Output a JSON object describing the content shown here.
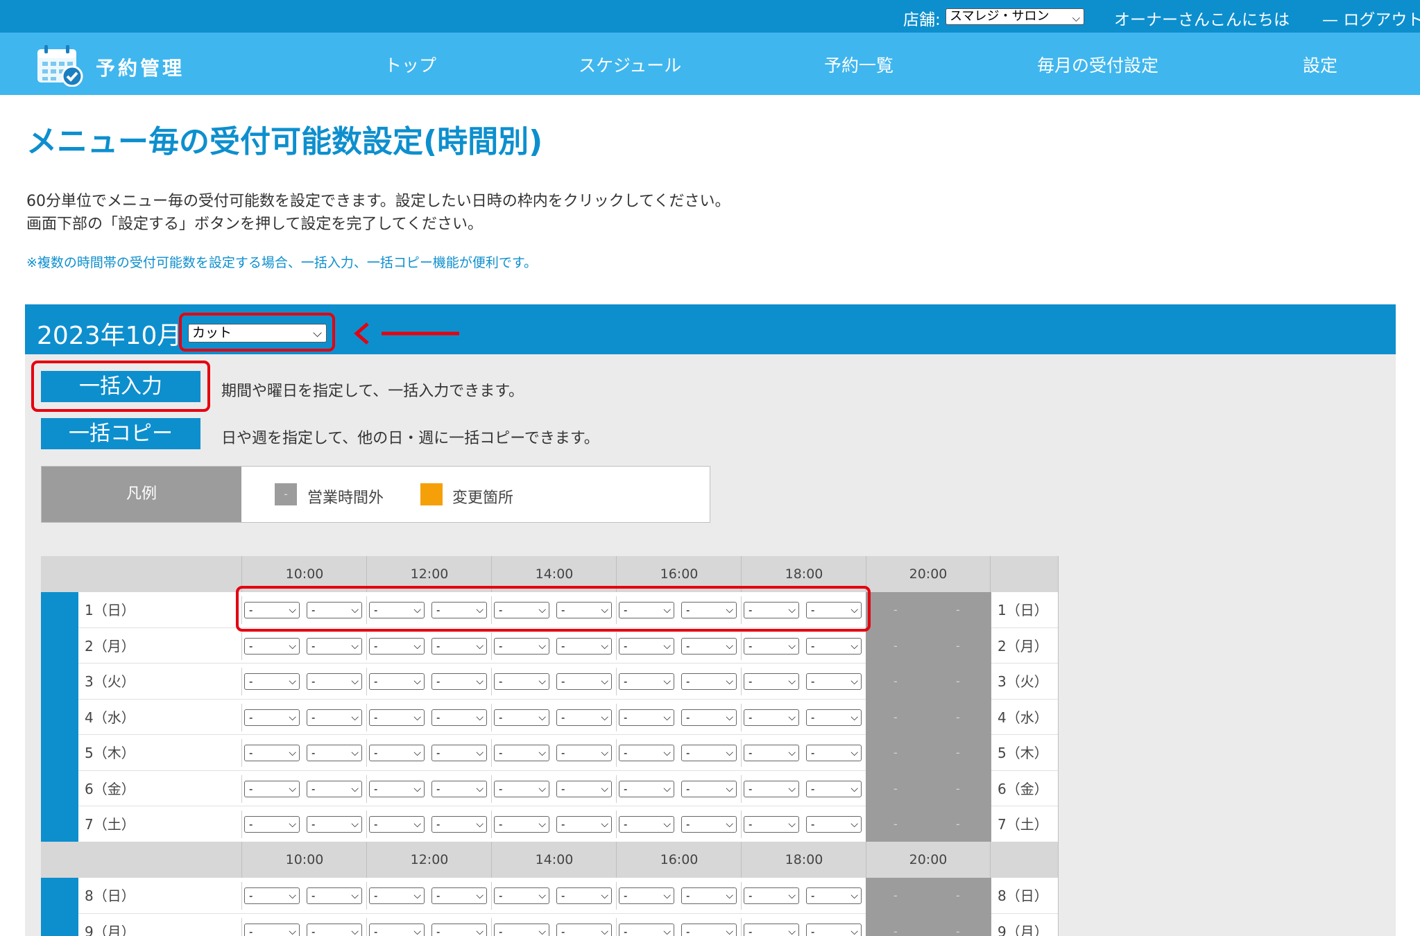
{
  "topbar": {
    "store_label": "店舗:",
    "store_value": "スマレジ・サロン",
    "greeting": "オーナーさんこんにちは",
    "separator": "—",
    "logout": "ログアウト"
  },
  "nav": {
    "brand": "予約管理",
    "items": [
      "トップ",
      "スケジュール",
      "予約一覧",
      "毎月の受付設定",
      "設定"
    ]
  },
  "page": {
    "title": "メニュー毎の受付可能数設定(時間別)",
    "desc1": "60分単位でメニュー毎の受付可能数を設定できます。設定したい日時の枠内をクリックしてください。",
    "desc2": "画面下部の「設定する」ボタンを押して設定を完了してください。",
    "note": "※複数の時間帯の受付可能数を設定する場合、一括入力、一括コピー機能が便利です。"
  },
  "panel": {
    "month": "2023年10月",
    "menu_value": "カット",
    "bulk_input_label": "一括入力",
    "bulk_input_desc": "期間や曜日を指定して、一括入力できます。",
    "bulk_copy_label": "一括コピー",
    "bulk_copy_desc": "日や週を指定して、他の日・週に一括コピーできます。",
    "legend": {
      "title": "凡例",
      "closed_label": "営業時間外",
      "closed_mark": "-",
      "changed_label": "変更箇所"
    }
  },
  "grid": {
    "hours": [
      "10:00",
      "12:00",
      "14:00",
      "16:00",
      "18:00",
      "20:00"
    ],
    "default_value": "-",
    "week1": [
      "1（日）",
      "2（月）",
      "3（火）",
      "4（水）",
      "5（木）",
      "6（金）",
      "7（土）"
    ],
    "week2": [
      "8（日）",
      "9（月）"
    ]
  },
  "colors": {
    "primary": "#0d8fce",
    "nav": "#40b6ee",
    "closed": "#9c9c9c",
    "changed": "#f5a009",
    "highlight": "#e5000f"
  }
}
